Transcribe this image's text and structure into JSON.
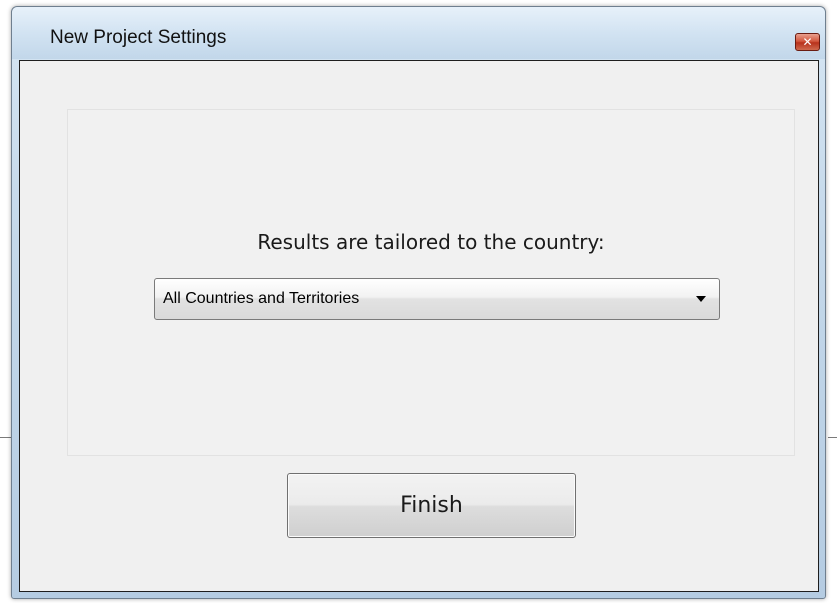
{
  "window": {
    "title": "New Project Settings",
    "close_glyph": "✕"
  },
  "form": {
    "prompt": "Results are tailored to the country:",
    "country_select": {
      "selected": "All Countries and Territories"
    }
  },
  "actions": {
    "finish_label": "Finish"
  },
  "icons": {
    "close": "close-icon",
    "dropdown": "chevron-down-icon"
  },
  "colors": {
    "close_button": "#c8452c",
    "title_bar": "#d2e3f2",
    "client_background": "#f0f0f0"
  }
}
